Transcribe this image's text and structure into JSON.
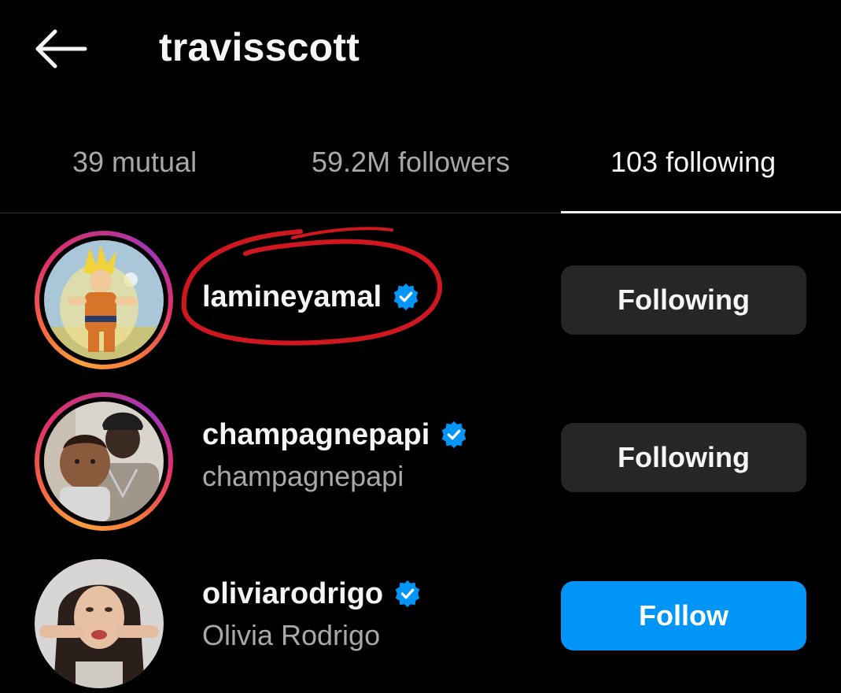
{
  "header": {
    "title": "travisscott",
    "back_icon": "arrow-left-icon"
  },
  "tabs": [
    {
      "label": "39 mutual",
      "active": false
    },
    {
      "label": "59.2M followers",
      "active": false
    },
    {
      "label": "103 following",
      "active": true
    }
  ],
  "users": [
    {
      "username": "lamineyamal",
      "full_name": "",
      "verified": true,
      "story_ring": true,
      "button_label": "Following",
      "button_style": "following"
    },
    {
      "username": "champagnepapi",
      "full_name": "champagnepapi",
      "verified": true,
      "story_ring": true,
      "button_label": "Following",
      "button_style": "following"
    },
    {
      "username": "oliviarodrigo",
      "full_name": "Olivia Rodrigo",
      "verified": true,
      "story_ring": false,
      "button_label": "Follow",
      "button_style": "follow"
    }
  ],
  "colors": {
    "background": "#000000",
    "text_primary": "#f5f5f5",
    "text_secondary": "#a8a8a8",
    "following_button": "#262626",
    "follow_button": "#0095f6",
    "verified_badge": "#0095f6",
    "annotation": "#d0161e"
  }
}
